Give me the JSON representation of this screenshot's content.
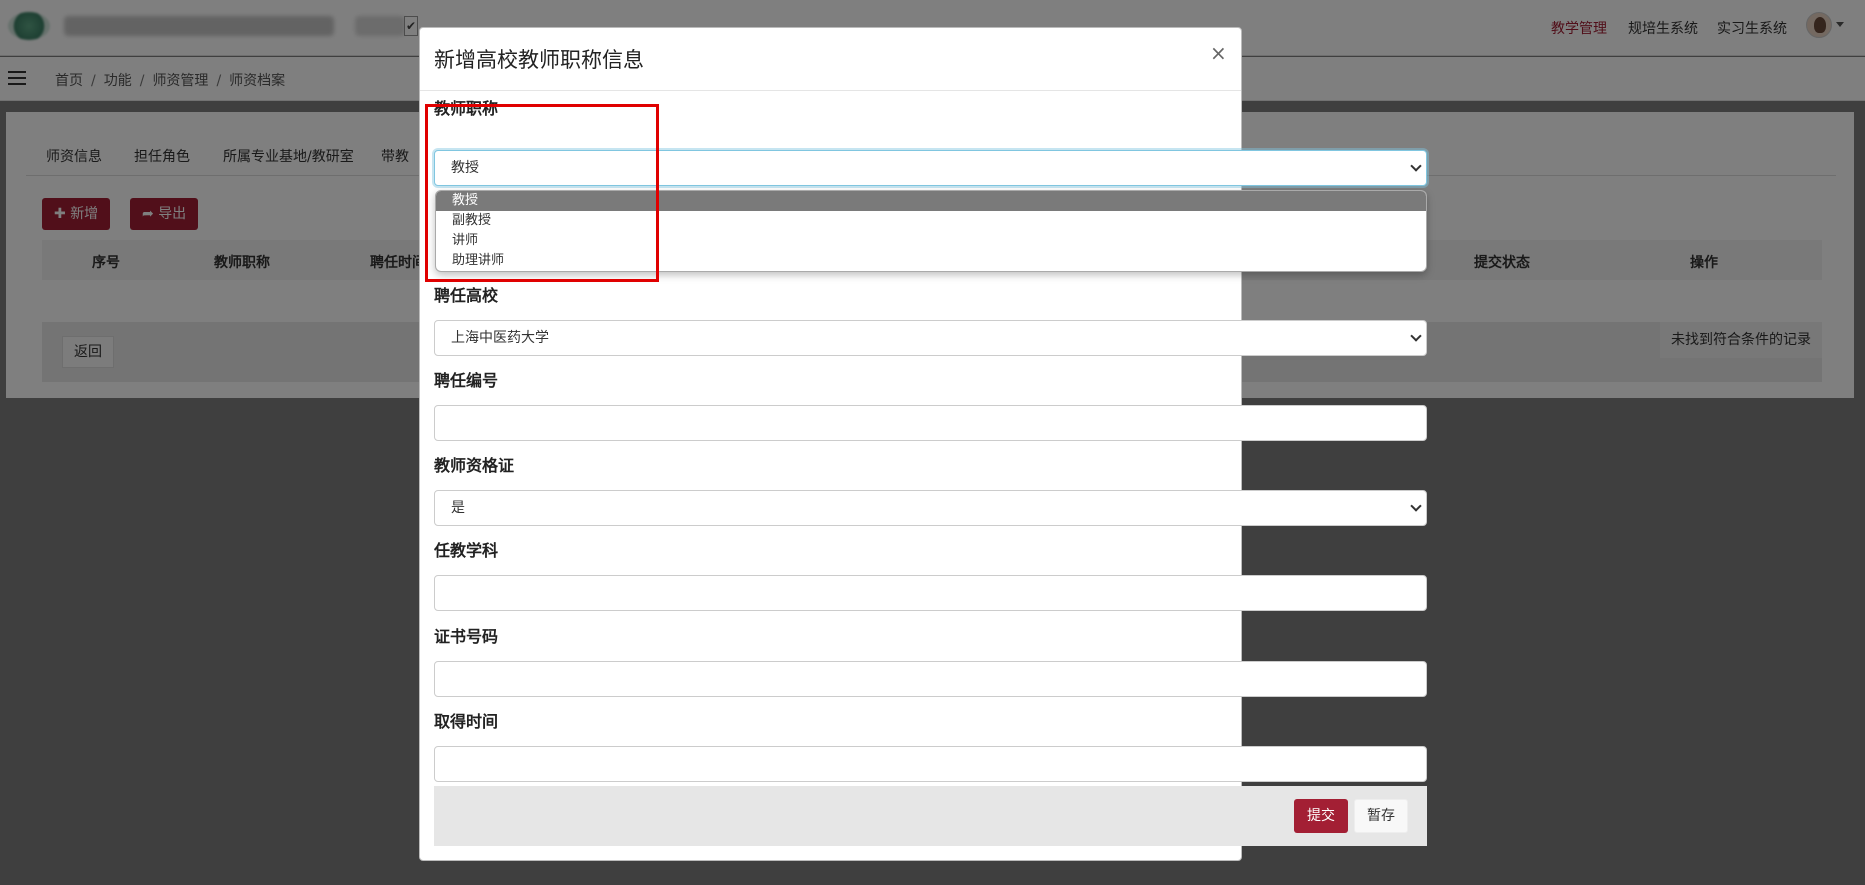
{
  "topbar": {
    "nav": [
      "教学管理",
      "规培生系统",
      "实习生系统"
    ],
    "active_index": 0
  },
  "breadcrumb": [
    "首页",
    "功能",
    "师资管理",
    "师资档案"
  ],
  "page": {
    "tabs": [
      "师资信息",
      "担任角色",
      "所属专业基地/教研室",
      "带教"
    ],
    "add_button": "新增",
    "export_button": "导出",
    "table_headers": [
      "序号",
      "教师职称",
      "聘任时间",
      "提交状态",
      "操作"
    ],
    "back_button": "返回",
    "empty_message": "未找到符合条件的记录"
  },
  "modal": {
    "title": "新增高校教师职称信息",
    "close_label": "×",
    "fields": {
      "title_rank": {
        "label": "教师职称",
        "value": "教授",
        "options": [
          "教授",
          "副教授",
          "讲师",
          "助理讲师"
        ],
        "selected_index": 0
      },
      "university": {
        "label": "聘任高校",
        "value": "上海中医药大学"
      },
      "appointment_no": {
        "label": "聘任编号",
        "value": ""
      },
      "certificate": {
        "label": "教师资格证",
        "value": "是"
      },
      "subject": {
        "label": "任教学科",
        "value": ""
      },
      "cert_no": {
        "label": "证书号码",
        "value": ""
      },
      "obtain_time": {
        "label": "取得时间",
        "value": ""
      }
    },
    "submit_button": "提交",
    "draft_button": "暂存"
  },
  "colors": {
    "accent": "#a31f34",
    "highlight": "#e00000",
    "focus": "#80c6e0"
  }
}
